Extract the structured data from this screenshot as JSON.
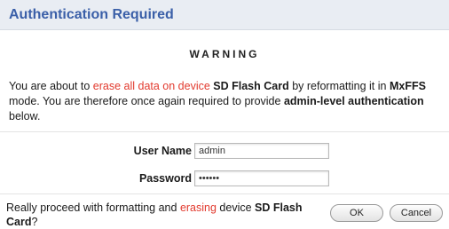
{
  "dialog": {
    "title": "Authentication Required",
    "warning_heading": "WARNING",
    "message": {
      "p1": "You are about to ",
      "red1": "erase all data on device",
      "p2": " ",
      "bold1": "SD Flash Card",
      "p3": " by reformatting it in ",
      "bold2": "MxFFS",
      "p4": " mode. You are therefore once again required to provide ",
      "bold3": "admin-level authentication",
      "p5": " below."
    },
    "form": {
      "username_label": "User Name",
      "username_value": "admin",
      "password_label": "Password",
      "password_value": "••••••"
    },
    "confirm": {
      "p1": "Really proceed with formatting and ",
      "red1": "erasing",
      "p2": " device ",
      "bold1": "SD Flash Card",
      "p3": "?"
    },
    "buttons": {
      "ok": "OK",
      "cancel": "Cancel"
    }
  }
}
